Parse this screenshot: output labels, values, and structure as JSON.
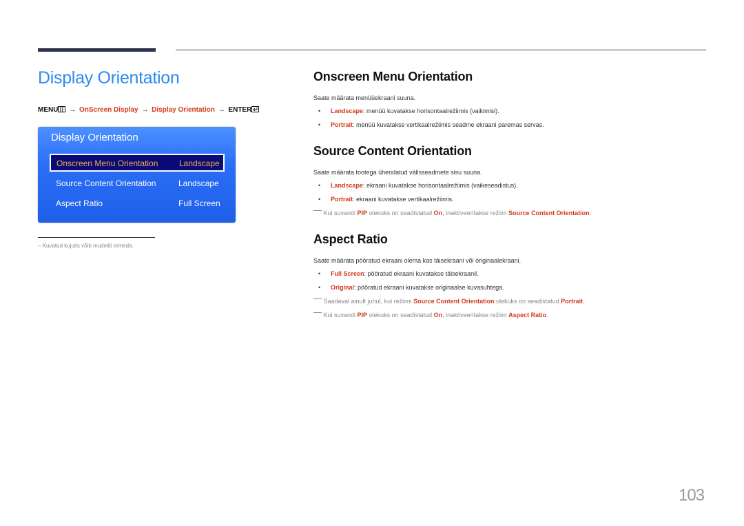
{
  "page_title": "Display Orientation",
  "menu_path": {
    "menu": "MENU",
    "step1": "OnScreen Display",
    "step2": "Display Orientation",
    "enter": "ENTER",
    "arrow": "→"
  },
  "osd": {
    "title": "Display Orientation",
    "rows": [
      {
        "label": "Onscreen Menu Orientation",
        "value": "Landscape",
        "selected": true
      },
      {
        "label": "Source Content Orientation",
        "value": "Landscape",
        "selected": false
      },
      {
        "label": "Aspect Ratio",
        "value": "Full Screen",
        "selected": false
      }
    ]
  },
  "footnote": "– Kuvatud kujutis võib mudeliti erineda.",
  "sections": {
    "onscreen": {
      "heading": "Onscreen Menu Orientation",
      "intro": "Saate määrata menüüekraani suuna.",
      "bullets": [
        {
          "term": "Landscape",
          "text": ": menüü kuvatakse horisontaalrežiimis (vaikimisi)."
        },
        {
          "term": "Portrait",
          "text": ": menüü kuvatakse vertikaalrežiimis seadme ekraani paremas servas."
        }
      ]
    },
    "source": {
      "heading": "Source Content Orientation",
      "intro": "Saate määrata tootega ühendatud välisseadmete sisu suuna.",
      "bullets": [
        {
          "term": "Landscape",
          "text": ": ekraani kuvatakse horisontaalrežiimis (vaikeseadistus)."
        },
        {
          "term": "Portrait",
          "text": ": ekraani kuvatakse vertikaalrežiimis."
        }
      ],
      "note": {
        "p1": "Kui suvandi ",
        "t1": "PIP",
        "p2": " olekuks on seadistatud ",
        "t2": "On",
        "p3": ", inaktiveeritakse režiim ",
        "t3": "Source Content Orientation",
        "p4": "."
      }
    },
    "aspect": {
      "heading": "Aspect Ratio",
      "intro": "Saate määrata pööratud ekraani olema kas täisekraani või originaalekraani.",
      "bullets": [
        {
          "term": "Full Screen",
          "text": ": pööratud ekraani kuvatakse täisekraanil."
        },
        {
          "term": "Original",
          "text": ": pööratud ekraani kuvatakse originaalse kuvasuhtega."
        }
      ],
      "note1": {
        "p1": "Saadaval ainult juhul, kui režiimi ",
        "t1": "Source Content Orientation",
        "p2": " olekuks on seadistatud ",
        "t2": "Portrait",
        "p3": "."
      },
      "note2": {
        "p1": "Kui suvandi ",
        "t1": "PIP",
        "p2": " olekuks on seadistatud ",
        "t2": "On",
        "p3": ", inaktiveeritakse režiim ",
        "t3": "Aspect Ratio",
        "p4": "."
      }
    }
  },
  "page_number": "103",
  "colors": {
    "title_blue": "#2d8bf0",
    "highlight_red": "#d03a1a",
    "osd_blue": "#2a6ef6",
    "osd_selected_bg": "#0a0a78",
    "osd_selected_text": "#f0b340"
  }
}
